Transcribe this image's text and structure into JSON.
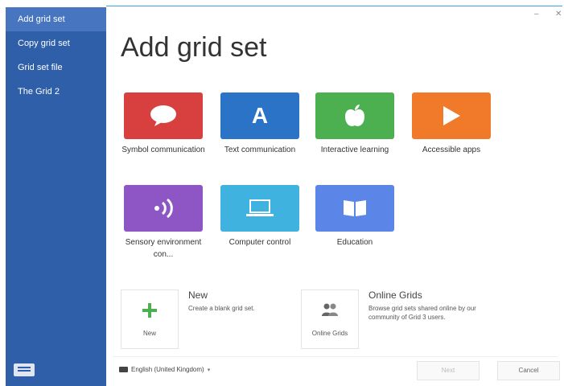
{
  "window": {
    "minimize_icon": "minimize-icon",
    "close_icon": "close-icon"
  },
  "sidebar": {
    "items": [
      {
        "label": "Add grid set",
        "active": true
      },
      {
        "label": "Copy grid set"
      },
      {
        "label": "Grid set file"
      },
      {
        "label": "The Grid 2"
      }
    ],
    "bottom_icon": "keyboard-icon"
  },
  "main": {
    "title": "Add grid set",
    "tiles": [
      {
        "label": "Symbol communication",
        "color": "#d84040",
        "icon": "speech-bubble-icon"
      },
      {
        "label": "Text communication",
        "color": "#2b73c7",
        "icon": "letter-a-icon",
        "glyph": "A"
      },
      {
        "label": "Interactive learning",
        "color": "#4caf50",
        "icon": "apple-icon"
      },
      {
        "label": "Accessible apps",
        "color": "#f07a2a",
        "icon": "play-icon"
      },
      {
        "label": "Sensory environment con...",
        "color": "#8e56c4",
        "icon": "signal-icon"
      },
      {
        "label": "Computer control",
        "color": "#3fb2df",
        "icon": "laptop-icon"
      },
      {
        "label": "Education",
        "color": "#5b86e8",
        "icon": "book-icon"
      }
    ],
    "options": [
      {
        "title": "New",
        "description": "Create a blank grid set.",
        "caption": "New",
        "icon": "plus-icon",
        "color": "#4caf50"
      },
      {
        "title": "Online Grids",
        "description": "Browse grid sets shared online by our community of Grid 3 users.",
        "caption": "Online Grids",
        "icon": "people-icon",
        "color": "#666666"
      }
    ]
  },
  "footer": {
    "language": "English (United Kingdom)",
    "language_icon": "keyboard-icon",
    "next_label": "Next",
    "cancel_label": "Cancel"
  }
}
